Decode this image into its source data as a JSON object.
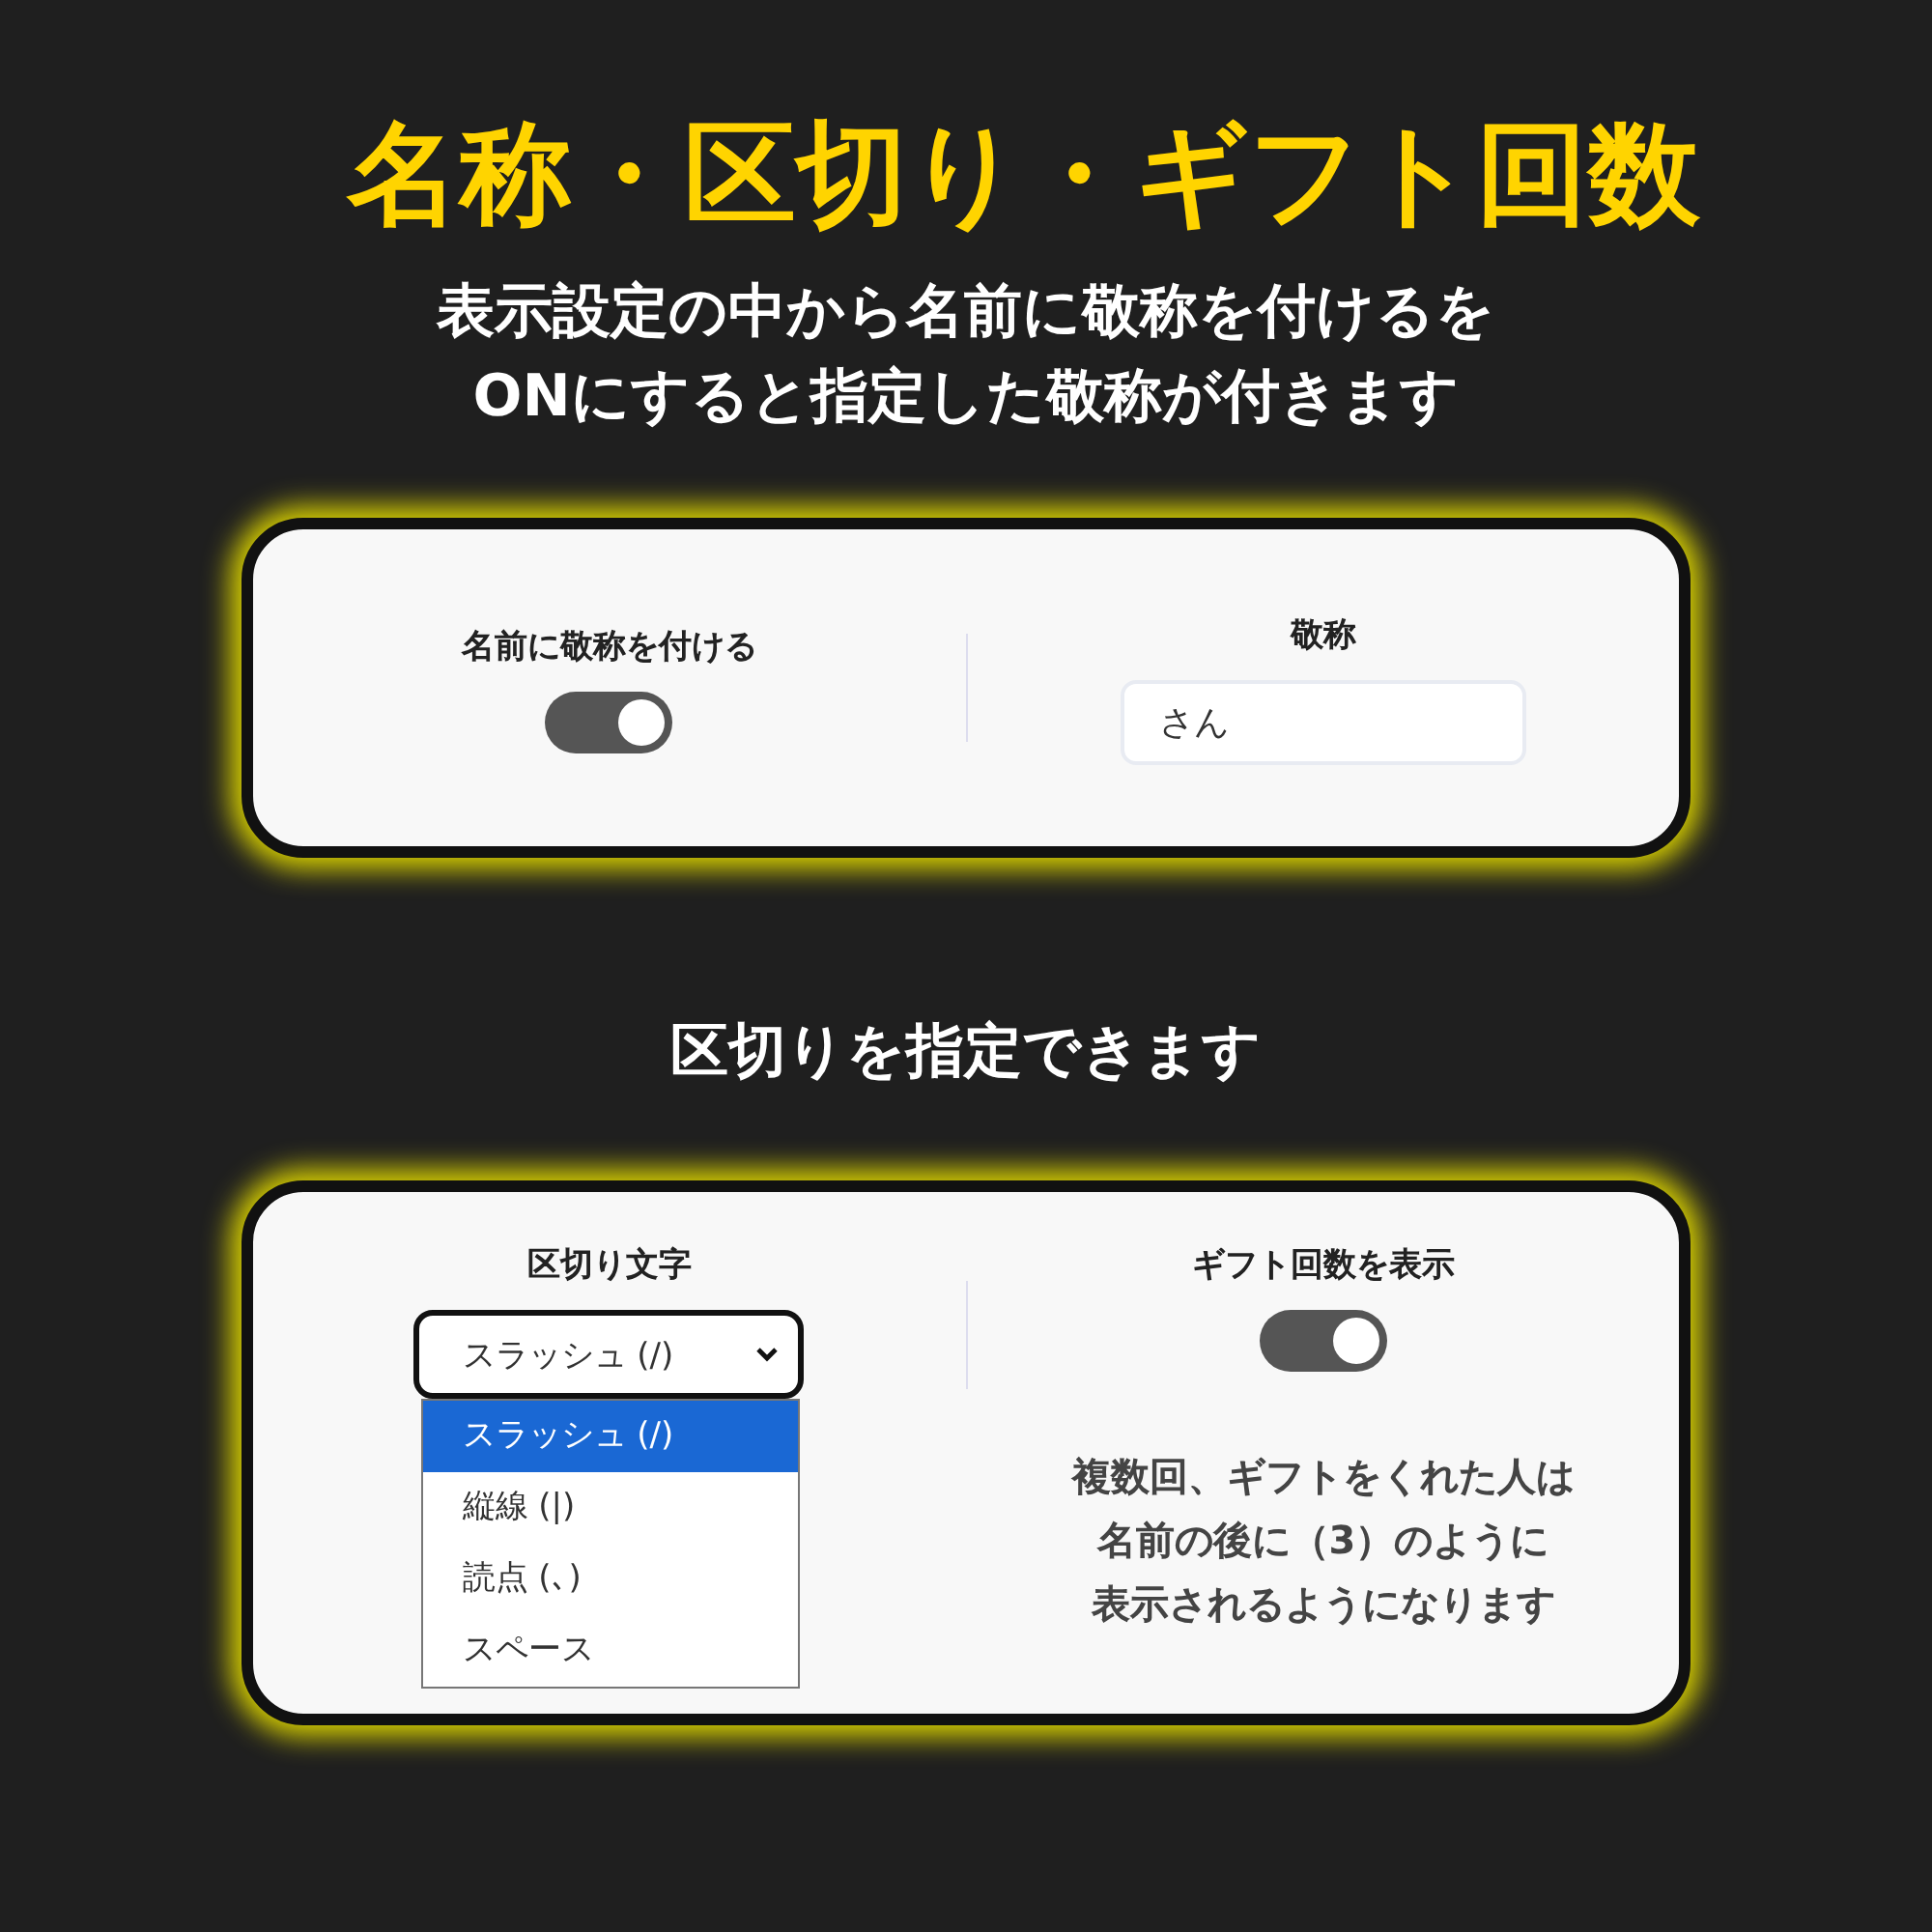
{
  "title": "名称・区切り・ギフト回数",
  "subtitle_lines": [
    "表示設定の中から名前に敬称を付けるを",
    "ONにすると指定した敬称が付きます"
  ],
  "honorific_panel": {
    "toggle": {
      "label": "名前に敬称を付ける",
      "on": true
    },
    "field": {
      "label": "敬称",
      "value": "さん"
    }
  },
  "separator_heading": "区切りを指定できます",
  "separator_panel": {
    "select": {
      "label": "区切り文字",
      "value": "スラッシュ (/)",
      "expanded": true,
      "options": [
        {
          "label": "スラッシュ (/)",
          "selected": true
        },
        {
          "label": "縦線 (|)",
          "selected": false
        },
        {
          "label": "読点 (､)",
          "selected": false
        },
        {
          "label": "スペース",
          "selected": false
        }
      ]
    },
    "toggle": {
      "label": "ギフト回数を表示",
      "on": true
    },
    "note_lines": [
      "複数回、ギフトをくれた人は",
      "名前の後に（3）のように",
      "表示されるようになります"
    ]
  }
}
